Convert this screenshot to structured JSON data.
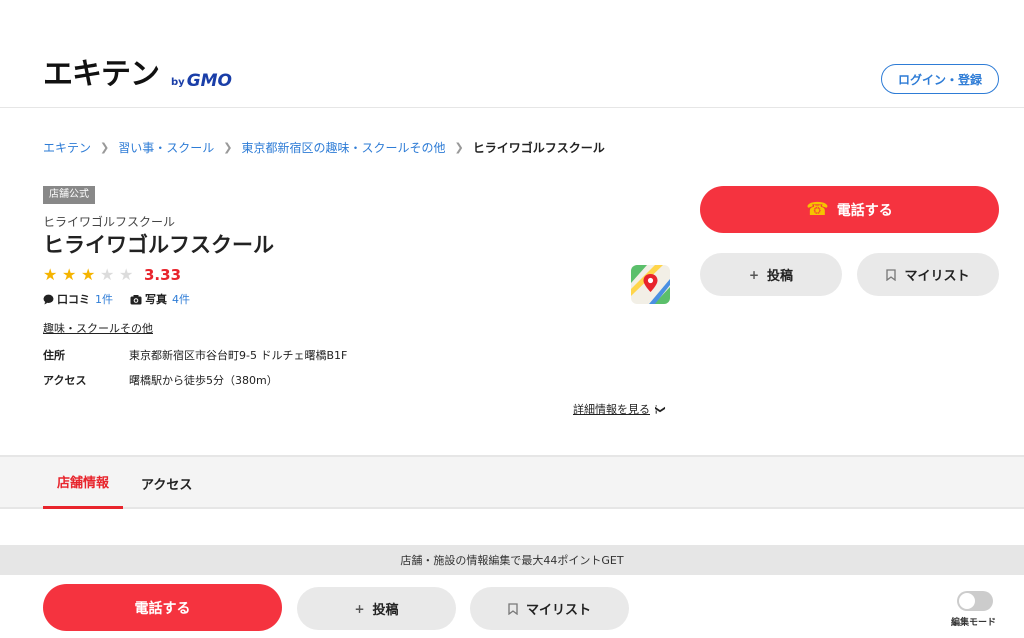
{
  "header": {
    "logo_text": "エキテン",
    "logo_by": "by",
    "logo_gmo": "GMO",
    "login_label": "ログイン・登録"
  },
  "breadcrumb": [
    "エキテン",
    "習い事・スクール",
    "東京都新宿区の趣味・スクールその他",
    "ヒライワゴルフスクール"
  ],
  "shop": {
    "badge": "店舗公式",
    "kana": "ヒライワゴルフスクール",
    "name": "ヒライワゴルフスクール",
    "rating": "3.33",
    "rating_stars": 3,
    "reviews_label": "口コミ",
    "reviews_count": "1件",
    "photos_label": "写真",
    "photos_count": "4件",
    "genre": "趣味・スクールその他",
    "address_label": "住所",
    "address": "東京都新宿区市谷台町9-5 ドルチェ曙橋B1F",
    "access_label": "アクセス",
    "access": "曙橋駅から徒歩5分（380m）",
    "detail_link": "詳細情報を見る"
  },
  "actions": {
    "call": "電話する",
    "post": "投稿",
    "mylist": "マイリスト"
  },
  "tabs": [
    {
      "label": "店舗情報",
      "active": true
    },
    {
      "label": "アクセス",
      "active": false
    }
  ],
  "bottom": {
    "promo": "店舗・施設の情報編集で最大44ポイントGET",
    "call": "電話する",
    "post": "投稿",
    "mylist": "マイリスト",
    "edit_mode": "編集モード"
  },
  "colors": {
    "accent_red": "#f5333f",
    "link_blue": "#2e7cd6",
    "star": "#f5b400"
  }
}
